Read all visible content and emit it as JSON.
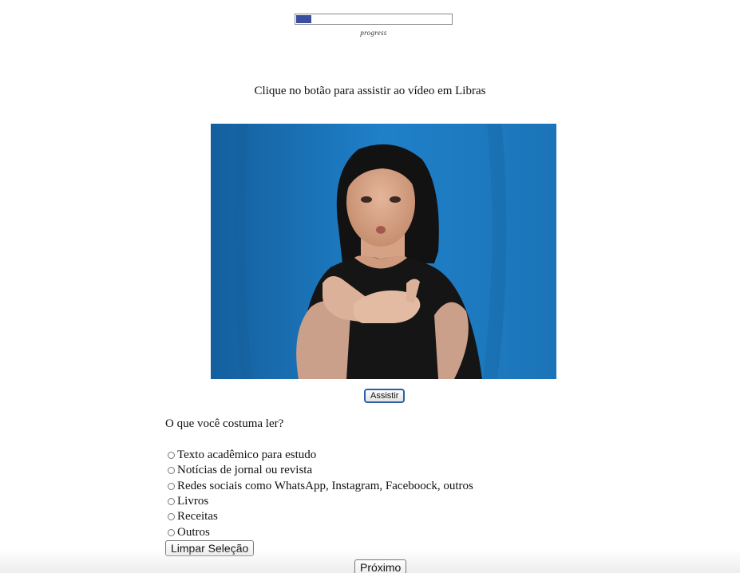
{
  "progress": {
    "label": "progress",
    "value": 0.1
  },
  "instruction": "Clique no botão para assistir ao vídeo em Libras",
  "video": {
    "icon": "sign-language-video-thumbnail"
  },
  "watch_button": "Assistir",
  "question": "O que você costuma ler?",
  "options": [
    "Texto acadêmico para estudo",
    "Notícias de jornal ou revista",
    "Redes sociais como WhatsApp, Instagram, Faceboock, outros",
    "Livros",
    "Receitas",
    "Outros"
  ],
  "clear_button": "Limpar Seleção",
  "next_button": "Próximo",
  "colors": {
    "progress_fill": "#3b4ea0",
    "video_background": "#1a6fb8",
    "button_border": "#2f5fa8"
  }
}
